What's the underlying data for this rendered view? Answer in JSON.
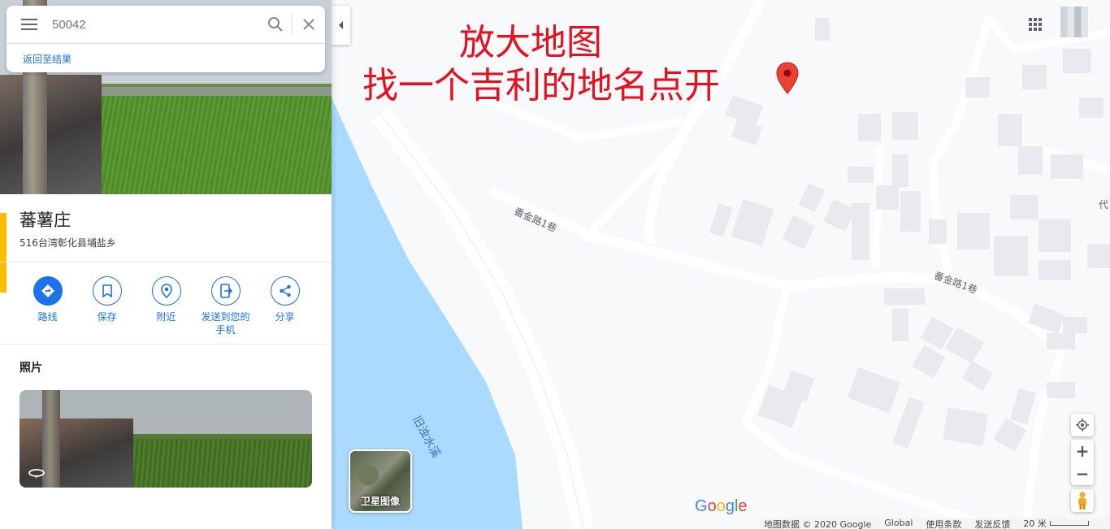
{
  "search": {
    "value": "50042",
    "back_label": "返回至结果"
  },
  "place": {
    "name": "蕃薯庄",
    "address": "516台湾彰化县埔盐乡"
  },
  "actions": [
    {
      "label": "路线",
      "icon": "directions-icon"
    },
    {
      "label": "保存",
      "icon": "bookmark-icon"
    },
    {
      "label": "附近",
      "icon": "nearby-icon"
    },
    {
      "label": "发送到您的手机",
      "icon": "send-to-phone-icon"
    },
    {
      "label": "分享",
      "icon": "share-icon"
    }
  ],
  "photos": {
    "title": "照片"
  },
  "map": {
    "annotation_line1": "放大地图",
    "annotation_line2": "找一个吉利的地名点开",
    "road_label_1": "番金路1巷",
    "road_label_2": "番金路1巷",
    "water_label": "旧浊水溪",
    "edge_label": "代",
    "satellite_label": "卫星图像",
    "logo": [
      "G",
      "o",
      "o",
      "g",
      "l",
      "e"
    ],
    "zoom_in": "+",
    "zoom_out": "−",
    "footer": {
      "data": "地图数据 © 2020 Google",
      "region": "Global",
      "terms": "使用条款",
      "feedback": "发送反馈",
      "scale": "20 米"
    },
    "colors": {
      "water": "#aadaff",
      "road": "#ffffff",
      "pin": "#ea4335",
      "accent": "#1a73e8"
    }
  }
}
